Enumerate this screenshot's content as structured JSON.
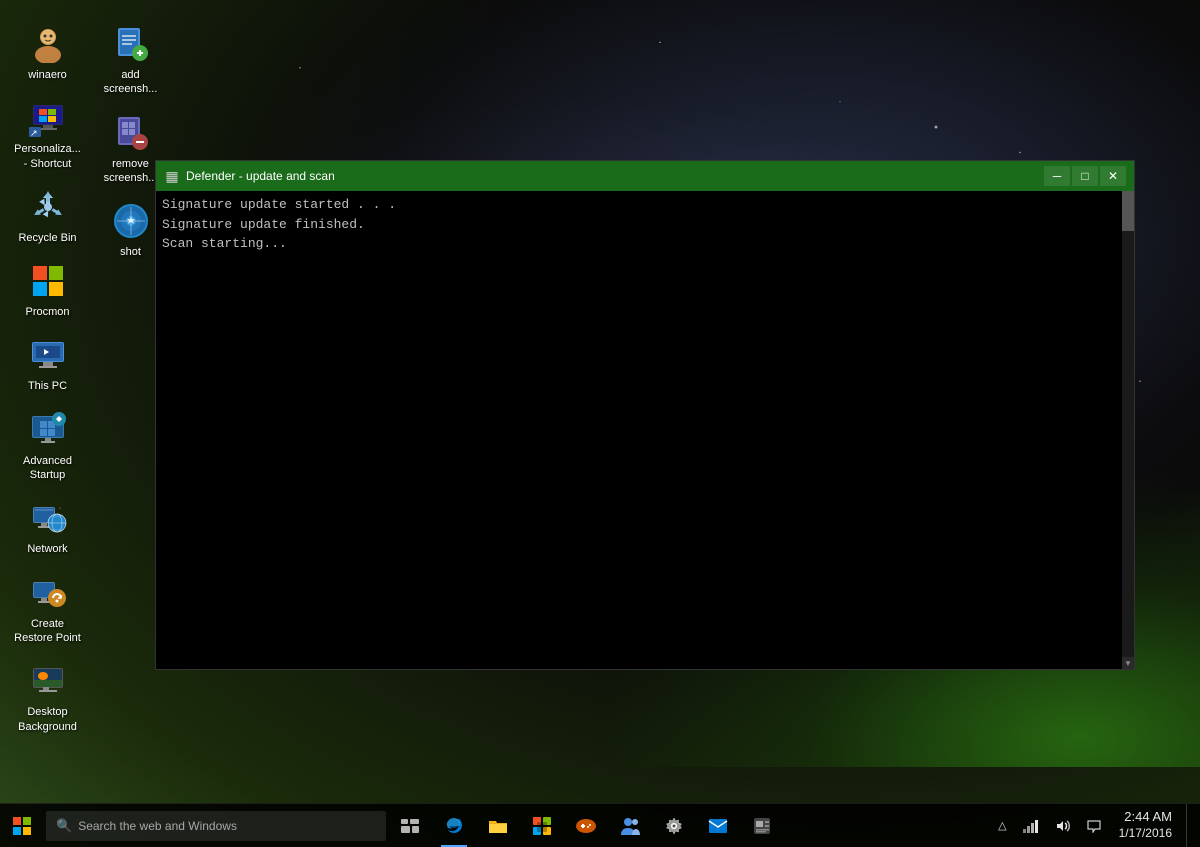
{
  "desktop": {
    "icons": [
      {
        "id": "winaero",
        "label": "winaero",
        "icon": "person"
      },
      {
        "id": "personaliza",
        "label": "Personaliza... - Shortcut",
        "icon": "settings"
      },
      {
        "id": "recycle-bin",
        "label": "Recycle Bin",
        "icon": "recycle"
      },
      {
        "id": "procmon",
        "label": "Procmon",
        "icon": "procmon"
      },
      {
        "id": "this-pc",
        "label": "This PC",
        "icon": "pc"
      },
      {
        "id": "advanced-startup",
        "label": "Advanced Startup",
        "icon": "advanced"
      },
      {
        "id": "network",
        "label": "Network",
        "icon": "network"
      },
      {
        "id": "create-restore",
        "label": "Create Restore Point",
        "icon": "restore"
      },
      {
        "id": "desktop-bg",
        "label": "Desktop Background",
        "icon": "desktop"
      },
      {
        "id": "add-screenshot",
        "label": "add screensh...",
        "icon": "addscreenshot"
      },
      {
        "id": "remove-screenshot",
        "label": "remove screensh...",
        "icon": "removescreenshot"
      },
      {
        "id": "shot",
        "label": "shot",
        "icon": "shot"
      }
    ]
  },
  "console_window": {
    "title": "Defender - update and scan",
    "content": "Signature update started . . .\nSignature update finished.\nScan starting...",
    "min_label": "─",
    "max_label": "□",
    "close_label": "✕"
  },
  "taskbar": {
    "start_icon": "⊞",
    "search_placeholder": "Search the web and Windows",
    "task_view_icon": "⧉",
    "edge_icon": "e",
    "file_explorer_icon": "📁",
    "store_icon": "🛍",
    "icons": [
      "⧉",
      "e",
      "📁",
      "🛍",
      "🎮",
      "👥",
      "⚙",
      "📧",
      "📰"
    ],
    "notif_icons": [
      "△",
      "□",
      "🔊",
      "💬"
    ],
    "clock": {
      "time": "2:44 AM",
      "date": "1/17/2016"
    }
  }
}
